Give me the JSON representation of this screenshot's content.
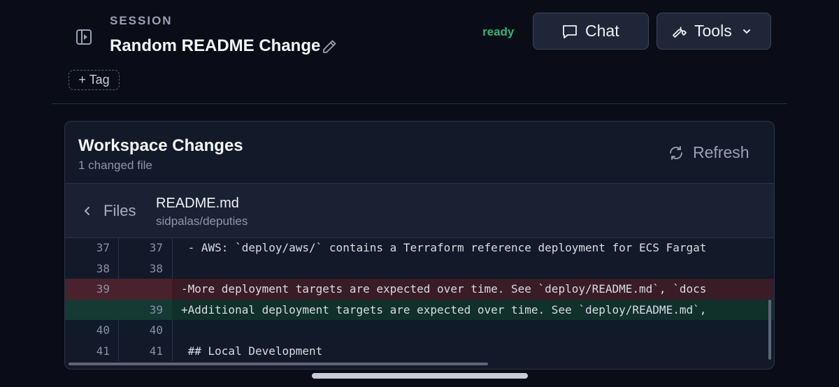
{
  "header": {
    "session_label": "SESSION",
    "title": "Random README Change",
    "tag_button": "+ Tag",
    "status": "ready",
    "chat_button": "Chat",
    "tools_button": "Tools"
  },
  "panel": {
    "title": "Workspace Changes",
    "subtitle": "1 changed file",
    "refresh_button": "Refresh",
    "back_label": "Files",
    "file_name": "README.md",
    "repo": "sidpalas/deputies",
    "rows": [
      {
        "old": "37",
        "new": "37",
        "code": " - AWS: `deploy/aws/` contains a Terraform reference deployment for ECS Fargat",
        "type": "context"
      },
      {
        "old": "38",
        "new": "38",
        "code": "",
        "type": "context"
      },
      {
        "old": "39",
        "new": "",
        "code": "-More deployment targets are expected over time. See `deploy/README.md`, `docs",
        "type": "del"
      },
      {
        "old": "",
        "new": "39",
        "code": "+Additional deployment targets are expected over time. See `deploy/README.md`,",
        "type": "add"
      },
      {
        "old": "40",
        "new": "40",
        "code": "",
        "type": "context"
      },
      {
        "old": "41",
        "new": "41",
        "code": " ## Local Development",
        "type": "context"
      }
    ]
  }
}
